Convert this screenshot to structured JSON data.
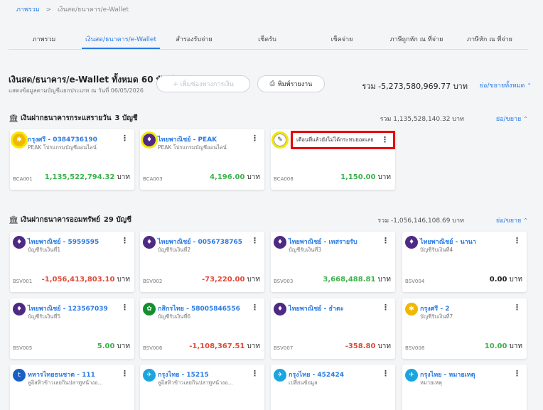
{
  "breadcrumb": {
    "home": "ภาพรวม",
    "current": "เงินสด/ธนาคาร/e-Wallet"
  },
  "tabs": [
    {
      "label": "ภาพรวม"
    },
    {
      "label": "เงินสด/ธนาคาร/e-Wallet"
    },
    {
      "label": "สำรองรับจ่าย"
    },
    {
      "label": "เช็ครับ"
    },
    {
      "label": "เช็คจ่าย"
    },
    {
      "label": "ภาษีถูกหัก ณ ที่จ่าย"
    },
    {
      "label": "ภาษีหัก ณ ที่จ่าย"
    }
  ],
  "summary": {
    "title": "เงินสด/ธนาคาร/e-Wallet ทั้งหมด 60 บัญชี",
    "subtitle": "แสดงข้อมูลตามบัญชีแยกประเภท ณ วันที่ 06/05/2026",
    "add_button": "+ เพิ่มช่องทางการเงิน",
    "print_button": "พิมพ์รายงาน",
    "total": "รวม -5,273,580,969.77 บาท",
    "toggle_all": "ย่อ/ขยายทั้งหมด"
  },
  "sections": {
    "current": {
      "title": "เงินฝากธนาคารกระแสรายวัน",
      "count": "3 บัญชี",
      "total": "รวม 1,135,528,140.32 บาท",
      "toggle": "ย่อ/ขยาย"
    },
    "savings": {
      "title": "เงินฝากธนาคารออมทรัพย์",
      "count": "29 บัญชี",
      "total": "รวม -1,056,146,108.69 บาท",
      "toggle": "ย่อ/ขยาย"
    }
  },
  "unit": "บาท",
  "warning_text": "เดือนที่แล้วยังไม่ได้กระทบยอดเลย",
  "current_cards": [
    {
      "name": "กรุงศรี - 0384736190",
      "desc": "PEAK โปรแกรมบัญชีออนไลน์",
      "code": "BCA001",
      "amount": "1,135,522,794.32",
      "status": "pos",
      "color": "#f2b705",
      "glyph": "✱"
    },
    {
      "name": "ไทยพาณิชย์ - PEAK",
      "desc": "PEAK โปรแกรมบัญชีออนไลน์",
      "code": "BCA003",
      "amount": "4,196.00",
      "status": "pos",
      "color": "#4e2a84",
      "glyph": "♦"
    },
    {
      "name": "",
      "desc": "",
      "code": "BCA008",
      "amount": "1,150.00",
      "status": "pos",
      "color": "#ffffff",
      "glyph": "✎"
    }
  ],
  "savings_cards": [
    {
      "name": "ไทยพาณิชย์ - 5959595",
      "desc": "บัญชีรับเงินที่1",
      "code": "BSV001",
      "amount": "-1,056,413,803.10",
      "status": "neg",
      "color": "#4e2a84",
      "glyph": "♦"
    },
    {
      "name": "ไทยพาณิชย์ - 0056738765",
      "desc": "บัญชีรับเงินที่2",
      "code": "BSV002",
      "amount": "-73,220.00",
      "status": "neg",
      "color": "#4e2a84",
      "glyph": "♦"
    },
    {
      "name": "ไทยพาณิชย์ - เทสรายรับ",
      "desc": "บัญชีรับเงินที่3",
      "code": "BSV003",
      "amount": "3,668,488.81",
      "status": "pos",
      "color": "#4e2a84",
      "glyph": "♦"
    },
    {
      "name": "ไทยพาณิชย์ - นานา",
      "desc": "บัญชีรับเงินที่4",
      "code": "BSV004",
      "amount": "0.00",
      "status": "zero",
      "color": "#4e2a84",
      "glyph": "♦"
    },
    {
      "name": "ไทยพาณิชย์ - 123567039",
      "desc": "บัญชีรับเงินที่5",
      "code": "BSV005",
      "amount": "5.00",
      "status": "pos",
      "color": "#4e2a84",
      "glyph": "♦"
    },
    {
      "name": "กสิกรไทย - 58005846556",
      "desc": "บัญชีรับเงินที่6",
      "code": "BSV006",
      "amount": "-1,108,367.51",
      "status": "neg",
      "color": "#138f2d",
      "glyph": "✿"
    },
    {
      "name": "ไทยพาณิชย์ - ธำตะ",
      "desc": "",
      "code": "BSV007",
      "amount": "-358.80",
      "status": "neg",
      "color": "#4e2a84",
      "glyph": "♦"
    },
    {
      "name": "กรุงศรี - 2",
      "desc": "บัญชีรับเงินที่7",
      "code": "BSV008",
      "amount": "10.00",
      "status": "pos",
      "color": "#f2b705",
      "glyph": "✱"
    },
    {
      "name": "ทหารไทยธนชาต - 111",
      "desc": "ลูอิสหิวข้าวเลยกินปลาทูหน้างอ...",
      "code": "",
      "amount": "",
      "status": "zero",
      "color": "#1b5fc4",
      "glyph": "t"
    },
    {
      "name": "กรุงไทย - 15215",
      "desc": "ลูอิสหิวข้าวเลยกินปลาทูหน้างอ...",
      "code": "",
      "amount": "",
      "status": "zero",
      "color": "#1ba5e0",
      "glyph": "✈"
    },
    {
      "name": "กรุงไทย - 452424",
      "desc": "เปลี่ยนข้อมูล",
      "code": "",
      "amount": "",
      "status": "zero",
      "color": "#1ba5e0",
      "glyph": "✈"
    },
    {
      "name": "กรุงไทย - หมายเหตุ",
      "desc": "หมายเหตุ",
      "code": "",
      "amount": "",
      "status": "zero",
      "color": "#1ba5e0",
      "glyph": "✈"
    }
  ]
}
